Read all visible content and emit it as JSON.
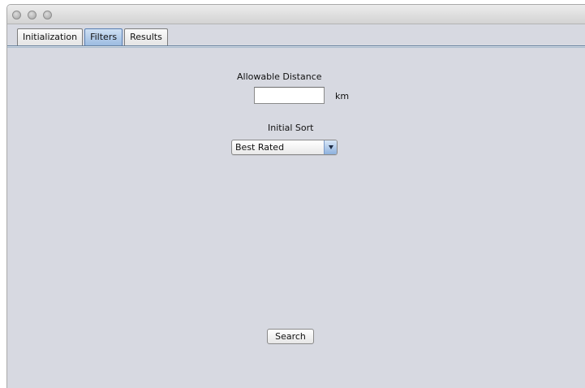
{
  "window": {
    "controls": [
      {
        "name": "close",
        "icon": "close-icon"
      },
      {
        "name": "minimize",
        "icon": "minimize-icon"
      },
      {
        "name": "zoom",
        "icon": "zoom-icon"
      }
    ]
  },
  "tabs": [
    {
      "label": "Initialization",
      "selected": false
    },
    {
      "label": "Filters",
      "selected": true
    },
    {
      "label": "Results",
      "selected": false
    }
  ],
  "filters": {
    "distance_label": "Allowable Distance",
    "distance_value": "",
    "distance_unit": "km",
    "sort_label": "Initial Sort",
    "sort_selected": "Best Rated",
    "search_label": "Search"
  },
  "colors": {
    "panel_background": "#d7d9e1",
    "selected_tab": "#9bbbe1",
    "tab_border": "#5e7a98"
  }
}
